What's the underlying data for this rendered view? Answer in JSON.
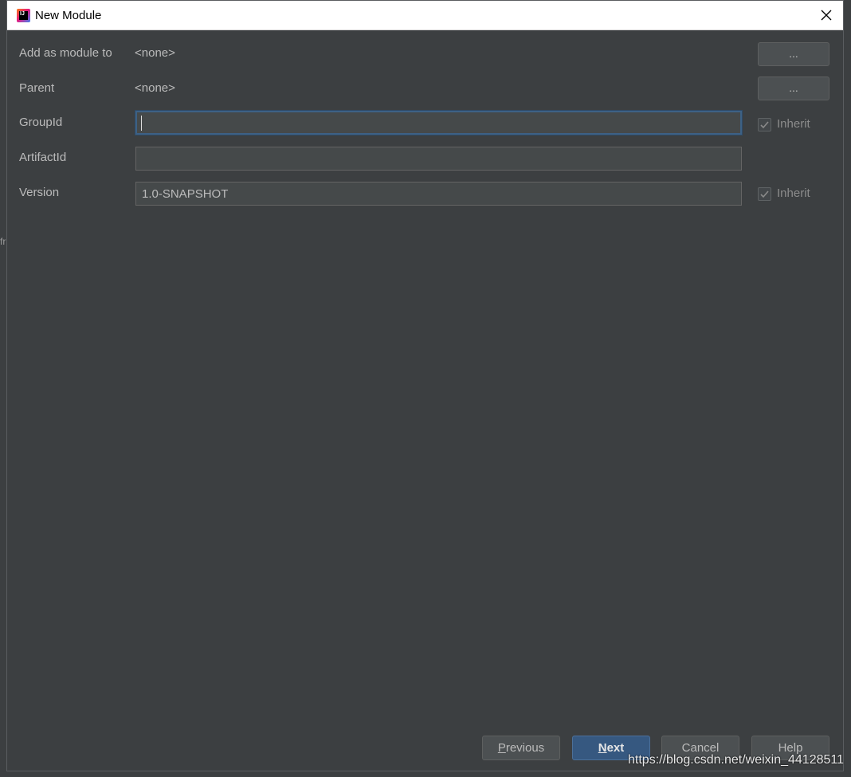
{
  "window": {
    "title": "New Module"
  },
  "form": {
    "add_as_module_to": {
      "label": "Add as module to",
      "value": "<none>",
      "button": "..."
    },
    "parent": {
      "label": "Parent",
      "value": "<none>",
      "button": "..."
    },
    "group_id": {
      "label": "GroupId",
      "value": "",
      "inherit_label": "Inherit",
      "inherit_checked": true
    },
    "artifact_id": {
      "label": "ArtifactId",
      "value": ""
    },
    "version": {
      "label": "Version",
      "value": "1.0-SNAPSHOT",
      "inherit_label": "Inherit",
      "inherit_checked": true
    }
  },
  "footer": {
    "previous": {
      "mnemonic": "P",
      "rest": "revious"
    },
    "next": {
      "mnemonic": "N",
      "rest": "ext"
    },
    "cancel": "Cancel",
    "help": "Help"
  },
  "watermark": "https://blog.csdn.net/weixin_44128511",
  "colors": {
    "dialog_bg": "#3c3f41",
    "field_bg": "#45494a",
    "focus_border": "#3d6185",
    "primary_button": "#365880"
  }
}
